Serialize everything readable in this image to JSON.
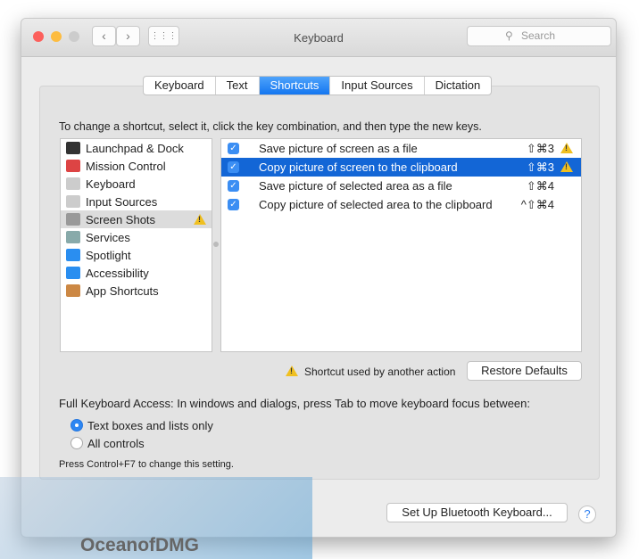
{
  "window": {
    "title": "Keyboard",
    "search_placeholder": "Search",
    "back": "‹",
    "forward": "›",
    "grid": "⋮⋮⋮"
  },
  "tabs": [
    "Keyboard",
    "Text",
    "Shortcuts",
    "Input Sources",
    "Dictation"
  ],
  "active_tab": "Shortcuts",
  "instructions": "To change a shortcut, select it, click the key combination, and then type the new keys.",
  "categories": [
    {
      "label": "Launchpad & Dock",
      "icon": "launchpad-icon",
      "color": "#333"
    },
    {
      "label": "Mission Control",
      "icon": "mission-control-icon",
      "color": "#d44"
    },
    {
      "label": "Keyboard",
      "icon": "keyboard-icon",
      "color": "#ccc"
    },
    {
      "label": "Input Sources",
      "icon": "keyboard-icon",
      "color": "#ccc"
    },
    {
      "label": "Screen Shots",
      "icon": "screenshot-icon",
      "color": "#999",
      "selected": true,
      "warning": true
    },
    {
      "label": "Services",
      "icon": "gear-icon",
      "color": "#8aa"
    },
    {
      "label": "Spotlight",
      "icon": "spotlight-icon",
      "color": "#2a8ef0"
    },
    {
      "label": "Accessibility",
      "icon": "accessibility-icon",
      "color": "#2a8ef0"
    },
    {
      "label": "App Shortcuts",
      "icon": "app-shortcuts-icon",
      "color": "#c84"
    }
  ],
  "shortcuts": [
    {
      "checked": true,
      "label": "Save picture of screen as a file",
      "keys": "⇧⌘3",
      "warning": true
    },
    {
      "checked": true,
      "label": "Copy picture of screen to the clipboard",
      "keys": "⇧⌘3",
      "warning": true,
      "selected": true
    },
    {
      "checked": true,
      "label": "Save picture of selected area as a file",
      "keys": "⇧⌘4"
    },
    {
      "checked": true,
      "label": "Copy picture of selected area to the clipboard",
      "keys": "^⇧⌘4"
    }
  ],
  "conflict_note": "Shortcut used by another action",
  "restore_defaults": "Restore Defaults",
  "fka_label": "Full Keyboard Access: In windows and dialogs, press Tab to move keyboard focus between:",
  "radio": [
    {
      "label": "Text boxes and lists only",
      "selected": true
    },
    {
      "label": "All controls",
      "selected": false
    }
  ],
  "hint": "Press Control+F7 to change this setting.",
  "bluetooth_button": "Set Up Bluetooth Keyboard...",
  "help": "?",
  "watermark": "OceanofDMG",
  "colors": {
    "accent": "#1476f0",
    "selection": "#1366d6",
    "warning": "#f0c020"
  }
}
